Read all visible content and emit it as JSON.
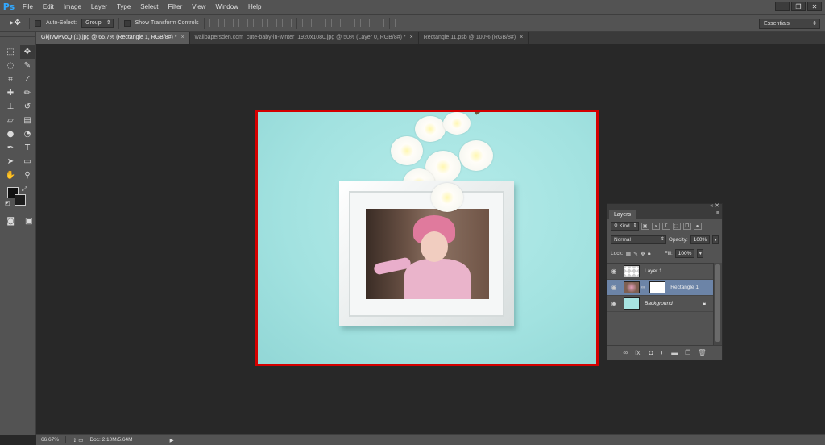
{
  "app": {
    "logo": "Ps",
    "menu": [
      "File",
      "Edit",
      "Image",
      "Layer",
      "Type",
      "Select",
      "Filter",
      "View",
      "Window",
      "Help"
    ],
    "window_controls": [
      "_",
      "❐",
      "✕"
    ]
  },
  "options_bar": {
    "auto_select_label": "Auto-Select:",
    "auto_select_value": "Group",
    "show_transform_label": "Show Transform Controls",
    "workspace": "Essentials"
  },
  "tabs": [
    {
      "label": "GkjIvwPvoQ (1).jpg @ 66.7% (Rectangle 1, RGB/8#) *",
      "active": true
    },
    {
      "label": "wallpapersden.com_cute-baby-in-winter_1920x1080.jpg @ 50% (Layer 0, RGB/8#) *",
      "active": false
    },
    {
      "label": "Rectangle 11.psb @ 100% (RGB/8#)",
      "active": false
    }
  ],
  "tab_close": "×",
  "tools": [
    "move-icon",
    "marquee-icon",
    "lasso-icon",
    "quick-select-icon",
    "crop-icon",
    "eyedropper-icon",
    "healing-icon",
    "brush-icon",
    "stamp-icon",
    "history-brush-icon",
    "eraser-icon",
    "gradient-icon",
    "blur-icon",
    "dodge-icon",
    "pen-icon",
    "type-icon",
    "path-select-icon",
    "shape-icon",
    "hand-icon",
    "zoom-icon"
  ],
  "colors": {
    "accent": "#31a8ff",
    "selection_border": "#d40000",
    "canvas_bg": "#a9e6e5",
    "selected_layer": "#6c84a7"
  },
  "layers_panel": {
    "tab": "Layers",
    "filter_kind": "Kind",
    "blend_mode": "Normal",
    "opacity_label": "Opacity:",
    "opacity_value": "100%",
    "lock_label": "Lock:",
    "fill_label": "Fill:",
    "fill_value": "100%",
    "layers": [
      {
        "name": "Layer 1",
        "selected": false
      },
      {
        "name": "Rectangle 1",
        "selected": true
      },
      {
        "name": "Background",
        "selected": false,
        "locked": true
      }
    ],
    "footer_icons": [
      "link-icon",
      "fx-icon",
      "mask-icon",
      "adjustment-icon",
      "folder-icon",
      "new-layer-icon",
      "trash-icon"
    ],
    "fx_label": "fx."
  },
  "status": {
    "zoom": "66.67%",
    "doc": "Doc: 2.10M/5.64M"
  }
}
